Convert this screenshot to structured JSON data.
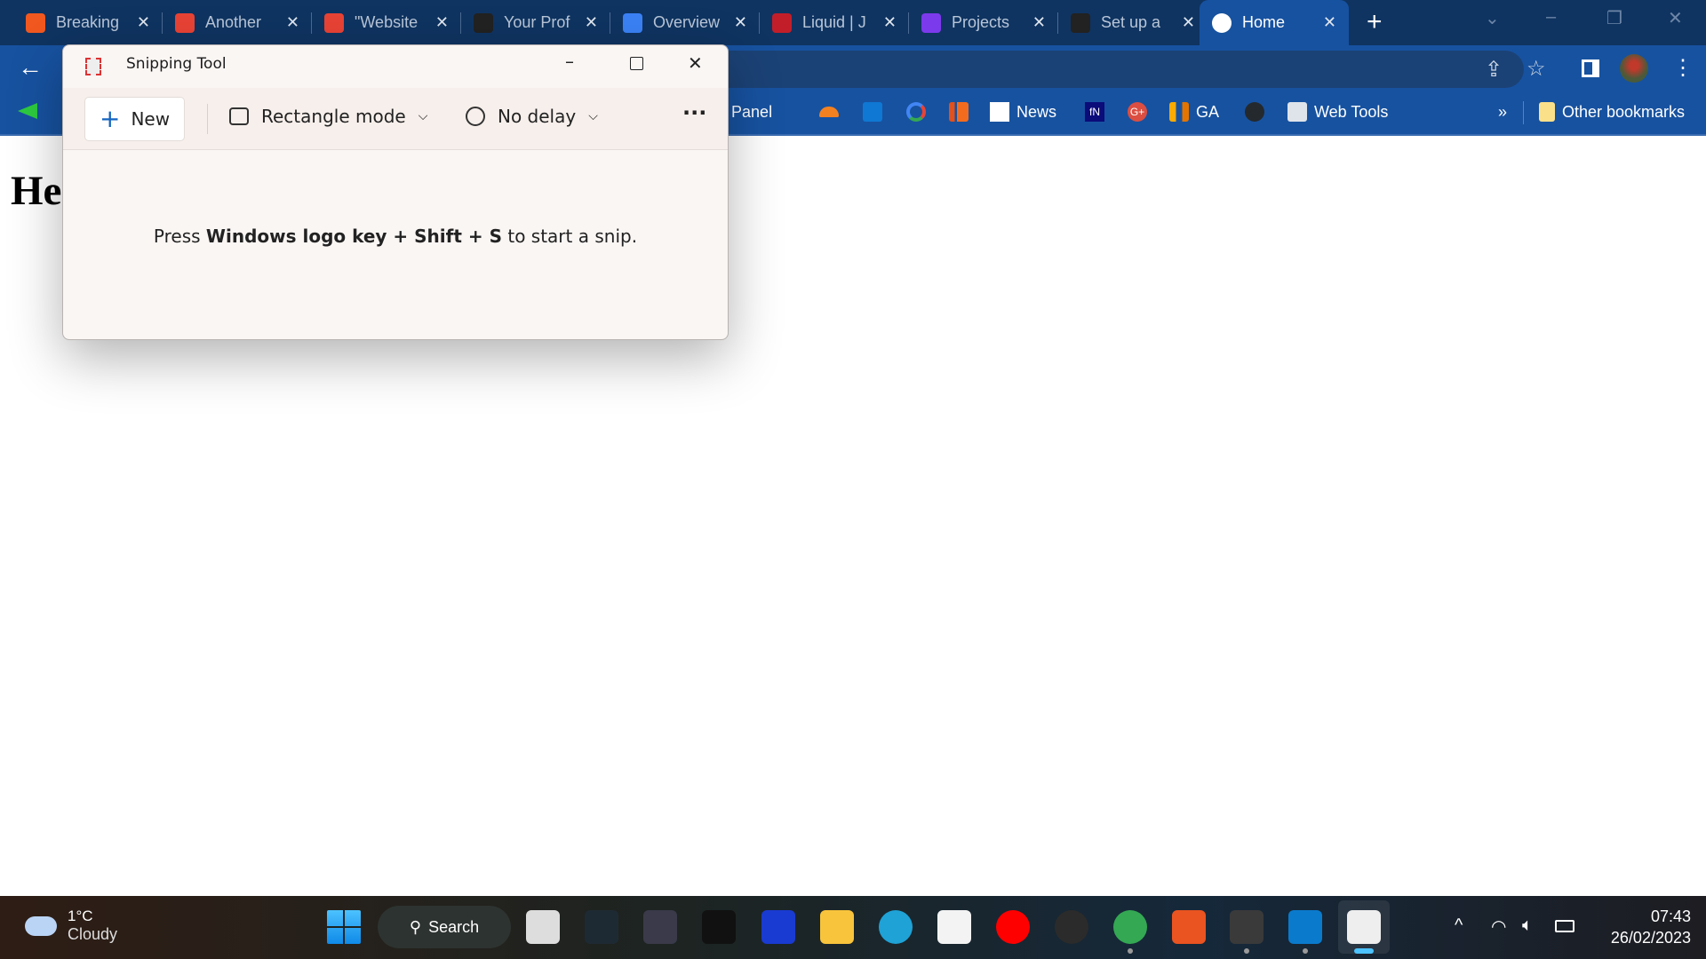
{
  "browser": {
    "tabs": [
      {
        "label": "Breaking",
        "icon": "orange-bars-icon",
        "color": "#f1581f"
      },
      {
        "label": "Another",
        "icon": "gmail-icon",
        "color": "#e94335"
      },
      {
        "label": "\"Website",
        "icon": "gmail-icon",
        "color": "#e94335"
      },
      {
        "label": "Your Prof",
        "icon": "github-icon",
        "color": "#222"
      },
      {
        "label": "Overview",
        "icon": "azure-devops-icon",
        "color": "#3b82f6"
      },
      {
        "label": "Liquid | J",
        "icon": "liquid-icon",
        "color": "#c21e2a"
      },
      {
        "label": "Projects",
        "icon": "canva-icon",
        "color": "#7c3aed"
      },
      {
        "label": "Set up a",
        "icon": "github-icon",
        "color": "#222"
      },
      {
        "label": "Home",
        "icon": "globe-icon",
        "color": "#ffffff",
        "active": true
      }
    ],
    "bookmarks": [
      {
        "label": "Control Panel"
      },
      {
        "label": "News"
      },
      {
        "label": "GA"
      },
      {
        "label": "Web Tools"
      },
      {
        "label": "Other bookmarks"
      }
    ],
    "overflow_label": "»"
  },
  "page": {
    "heading": "He"
  },
  "snipping_tool": {
    "title": "Snipping Tool",
    "new_label": "New",
    "mode_label": "Rectangle mode",
    "delay_label": "No delay",
    "msg_pre": "Press ",
    "msg_bold": "Windows logo key + Shift + S",
    "msg_post": " to start a snip."
  },
  "taskbar": {
    "weather_temp": "1°C",
    "weather_desc": "Cloudy",
    "search_label": "Search",
    "time": "07:43",
    "date": "26/02/2023"
  }
}
